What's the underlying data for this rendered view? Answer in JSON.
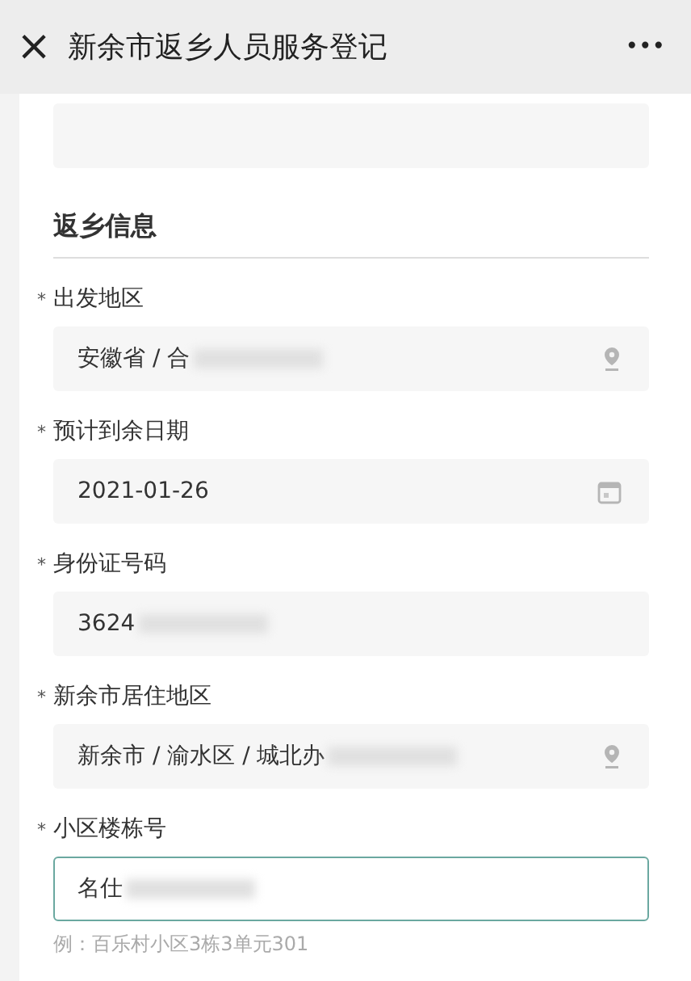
{
  "window": {
    "title": "新余市返乡人员服务登记",
    "close": "×",
    "more": "•••"
  },
  "section": {
    "title": "返乡信息"
  },
  "fields": [
    {
      "label": "出发地区",
      "required_mark": "*",
      "kind": "location",
      "value": "安徽省 / 合",
      "redacted": true,
      "focused": false
    },
    {
      "label": "预计到余日期",
      "required_mark": "*",
      "kind": "date",
      "value": "2021-01-26",
      "redacted": false,
      "focused": false
    },
    {
      "label": "身份证号码",
      "required_mark": "*",
      "kind": "text",
      "value": "3624",
      "redacted": true,
      "focused": false
    },
    {
      "label": "新余市居住地区",
      "required_mark": "*",
      "kind": "location",
      "value": "新余市 / 渝水区 / 城北办",
      "redacted": true,
      "focused": false
    },
    {
      "label": "小区楼栋号",
      "required_mark": "*",
      "kind": "text",
      "value": "名仕",
      "redacted": true,
      "focused": true,
      "hint": "例：百乐村小区3栋3单元301"
    }
  ]
}
